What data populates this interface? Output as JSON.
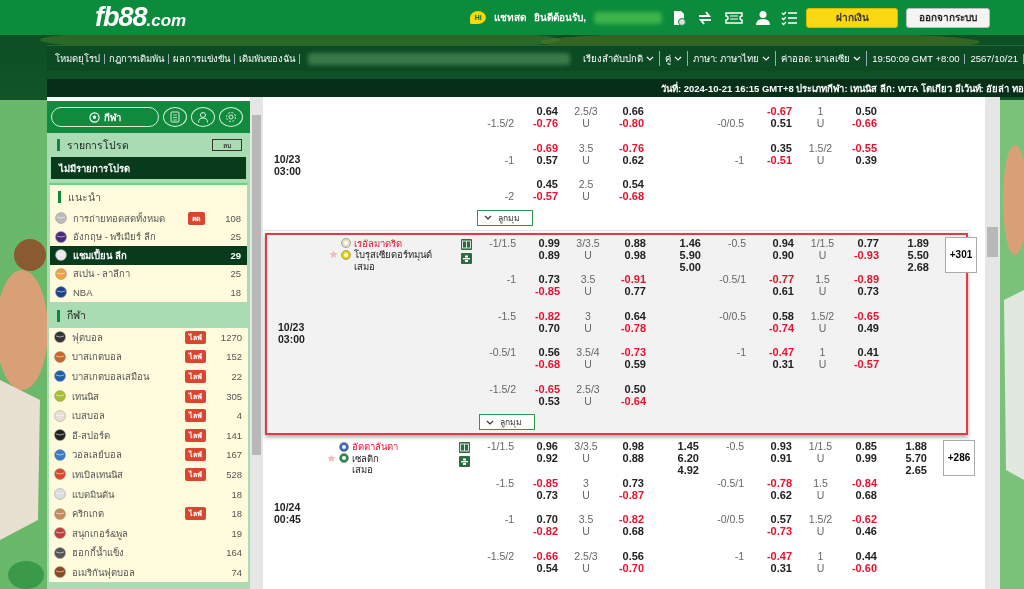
{
  "header": {
    "logo": "fb88",
    "logo_suffix": ".com",
    "chat_badge": "Hi",
    "chat_label": "แชทสด",
    "welcome": "ยินดีต้อนรับ,",
    "buttons": [
      {
        "label": "ฝากเงิน",
        "kind": "primary"
      },
      {
        "label": "ออกจากระบบ",
        "kind": "secondary"
      }
    ]
  },
  "nav": {
    "links": [
      "โหมดยุโรป",
      "กฎการเดิมพัน",
      "ผลการแข่งขัน",
      "เดิมพันของฉัน"
    ],
    "dropdowns": [
      "เรียงลำดับปกติ",
      "คู่",
      "ภาษา: ภาษาไทย",
      "ค่าออด: มาเลเซีย"
    ],
    "clock": "19:50:09 GMT +8:00",
    "date": "2567/10/21"
  },
  "ticker": "วันที่: 2024-10-21 16:15 GMT+8 ประเภทกีฬา: เทนนิส ลีก: WTA โตเกียว อีเว้นท์: อัยล่า ทอ",
  "sidebar": {
    "sports_button": "กีฬา",
    "favorites": {
      "title": "รายการโปรด",
      "clear": "ลบ",
      "empty": "ไม่มีรายการโปรด"
    },
    "recommended": {
      "title": "แนะนำ",
      "items": [
        {
          "name": "การถ่ายทอดสดทั้งหมด",
          "badge": "สด",
          "count": "108",
          "selected": false
        },
        {
          "name": "อังกฤษ - พรีเมียร์ ลีก",
          "count": "25",
          "selected": false
        },
        {
          "name": "แชมเปี้ยน ลีก",
          "count": "29",
          "selected": true
        },
        {
          "name": "สเปน - ลาลีกา",
          "count": "25",
          "selected": false
        },
        {
          "name": "NBA",
          "count": "18",
          "selected": false
        }
      ]
    },
    "sports": {
      "title": "กีฬา",
      "items": [
        {
          "name": "ฟุตบอล",
          "badge": "ไลฟ์",
          "count": "1270"
        },
        {
          "name": "บาสเกตบอล",
          "badge": "ไลฟ์",
          "count": "152"
        },
        {
          "name": "บาสเกตบอลเสมือน",
          "badge": "ไลฟ์",
          "count": "22"
        },
        {
          "name": "เทนนิส",
          "badge": "ไลฟ์",
          "count": "305"
        },
        {
          "name": "เบสบอล",
          "badge": "ไลฟ์",
          "count": "4"
        },
        {
          "name": "อี-สปอร์ต",
          "badge": "ไลฟ์",
          "count": "141"
        },
        {
          "name": "วอลเลย์บอล",
          "badge": "ไลฟ์",
          "count": "167"
        },
        {
          "name": "เทเบิลเทนนิส",
          "badge": "ไลฟ์",
          "count": "528"
        },
        {
          "name": "แบดมินตัน",
          "count": "18"
        },
        {
          "name": "คริกเกต",
          "badge": "ไลฟ์",
          "count": "18"
        },
        {
          "name": "สนุกเกอร์&พูล",
          "count": "19"
        },
        {
          "name": "ฮอกกี้น้ำแข็ง",
          "count": "164"
        },
        {
          "name": "อเมริกันฟุตบอล",
          "count": "74"
        }
      ]
    }
  },
  "matches": [
    {
      "date": "10/23",
      "time": "03:00",
      "highlighted": false,
      "home_favored": false,
      "corners": "ลูกมุม",
      "lines": [
        {
          "hdp": "-1.5/2",
          "h": [
            "0.64",
            "-0.76"
          ],
          "ou": [
            "2.5/3",
            "U"
          ],
          "o": [
            "0.66",
            "-0.80"
          ],
          "hdp2": "-0/0.5",
          "h2": [
            "-0.67",
            "0.51"
          ],
          "ou2": [
            "1",
            "U"
          ],
          "o2": [
            "0.50",
            "-0.66"
          ]
        },
        {
          "hdp": "-1",
          "h": [
            "-0.69",
            "0.57"
          ],
          "ou": [
            "3.5",
            "U"
          ],
          "o": [
            "-0.76",
            "0.62"
          ],
          "hdp2": "-1",
          "h2": [
            "0.35",
            "-0.51"
          ],
          "ou2": [
            "1.5/2",
            "U"
          ],
          "o2": [
            "-0.55",
            "0.39"
          ]
        },
        {
          "hdp": "-2",
          "h": [
            "0.45",
            "-0.57"
          ],
          "ou": [
            "2.5",
            "U"
          ],
          "o": [
            "0.54",
            "-0.68"
          ]
        }
      ]
    },
    {
      "date": "10/23",
      "time": "03:00",
      "highlighted": true,
      "home_favored": true,
      "teams": {
        "home": "เรอัลมาดริด",
        "away": "โบรุสเซียดอร์ทมุนด์",
        "draw": "เสมอ"
      },
      "x12": [
        "1.46",
        "5.90",
        "5.00"
      ],
      "x12_2h": [
        "1.89",
        "5.50",
        "2.68"
      ],
      "more": "+301",
      "corners": "ลูกมุม",
      "lines": [
        {
          "hdp": "-1/1.5",
          "h": [
            "0.99",
            "0.89"
          ],
          "ou": [
            "3/3.5",
            "U"
          ],
          "o": [
            "0.88",
            "0.98"
          ],
          "hdp2": "-0.5",
          "h2": [
            "0.94",
            "0.90"
          ],
          "ou2": [
            "1/1.5",
            "U"
          ],
          "o2": [
            "0.77",
            "-0.93"
          ]
        },
        {
          "hdp": "-1",
          "h": [
            "0.73",
            "-0.85"
          ],
          "ou": [
            "3.5",
            "U"
          ],
          "o": [
            "-0.91",
            "0.77"
          ],
          "hdp2": "-0.5/1",
          "h2": [
            "-0.77",
            "0.61"
          ],
          "ou2": [
            "1.5",
            "U"
          ],
          "o2": [
            "-0.89",
            "0.73"
          ]
        },
        {
          "hdp": "-1.5",
          "h": [
            "-0.82",
            "0.70"
          ],
          "ou": [
            "3",
            "U"
          ],
          "o": [
            "0.64",
            "-0.78"
          ],
          "hdp2": "-0/0.5",
          "h2": [
            "0.58",
            "-0.74"
          ],
          "ou2": [
            "1.5/2",
            "U"
          ],
          "o2": [
            "-0.65",
            "0.49"
          ]
        },
        {
          "hdp": "-0.5/1",
          "h": [
            "0.56",
            "-0.68"
          ],
          "ou": [
            "3.5/4",
            "U"
          ],
          "o": [
            "-0.73",
            "0.59"
          ],
          "hdp2": "-1",
          "h2": [
            "-0.47",
            "0.31"
          ],
          "ou2": [
            "1",
            "U"
          ],
          "o2": [
            "0.41",
            "-0.57"
          ]
        },
        {
          "hdp": "-1.5/2",
          "h": [
            "-0.65",
            "0.53"
          ],
          "ou": [
            "2.5/3",
            "U"
          ],
          "o": [
            "0.50",
            "-0.64"
          ]
        }
      ]
    },
    {
      "date": "10/24",
      "time": "00:45",
      "highlighted": false,
      "home_favored": true,
      "teams": {
        "home": "อัตตาลันตา",
        "away": "เซลติก",
        "draw": "เสมอ"
      },
      "x12": [
        "1.45",
        "6.20",
        "4.92"
      ],
      "x12_2h": [
        "1.88",
        "5.70",
        "2.65"
      ],
      "more": "+286",
      "lines": [
        {
          "hdp": "-1/1.5",
          "h": [
            "0.96",
            "0.92"
          ],
          "ou": [
            "3/3.5",
            "U"
          ],
          "o": [
            "0.98",
            "0.88"
          ],
          "hdp2": "-0.5",
          "h2": [
            "0.93",
            "0.91"
          ],
          "ou2": [
            "1/1.5",
            "U"
          ],
          "o2": [
            "0.85",
            "0.99"
          ]
        },
        {
          "hdp": "-1.5",
          "h": [
            "-0.85",
            "0.73"
          ],
          "ou": [
            "3",
            "U"
          ],
          "o": [
            "0.73",
            "-0.87"
          ],
          "hdp2": "-0.5/1",
          "h2": [
            "-0.78",
            "0.62"
          ],
          "ou2": [
            "1.5",
            "U"
          ],
          "o2": [
            "-0.84",
            "0.68"
          ]
        },
        {
          "hdp": "-1",
          "h": [
            "0.70",
            "-0.82"
          ],
          "ou": [
            "3.5",
            "U"
          ],
          "o": [
            "-0.82",
            "0.68"
          ],
          "hdp2": "-0/0.5",
          "h2": [
            "0.57",
            "-0.73"
          ],
          "ou2": [
            "1.5/2",
            "U"
          ],
          "o2": [
            "-0.62",
            "0.46"
          ]
        },
        {
          "hdp": "-1.5/2",
          "h": [
            "-0.66",
            "0.54"
          ],
          "ou": [
            "2.5/3",
            "U"
          ],
          "o": [
            "0.56",
            "-0.70"
          ],
          "hdp2": "-1",
          "h2": [
            "-0.47",
            "0.31"
          ],
          "ou2": [
            "1",
            "U"
          ],
          "o2": [
            "0.44",
            "-0.60"
          ]
        }
      ]
    }
  ]
}
